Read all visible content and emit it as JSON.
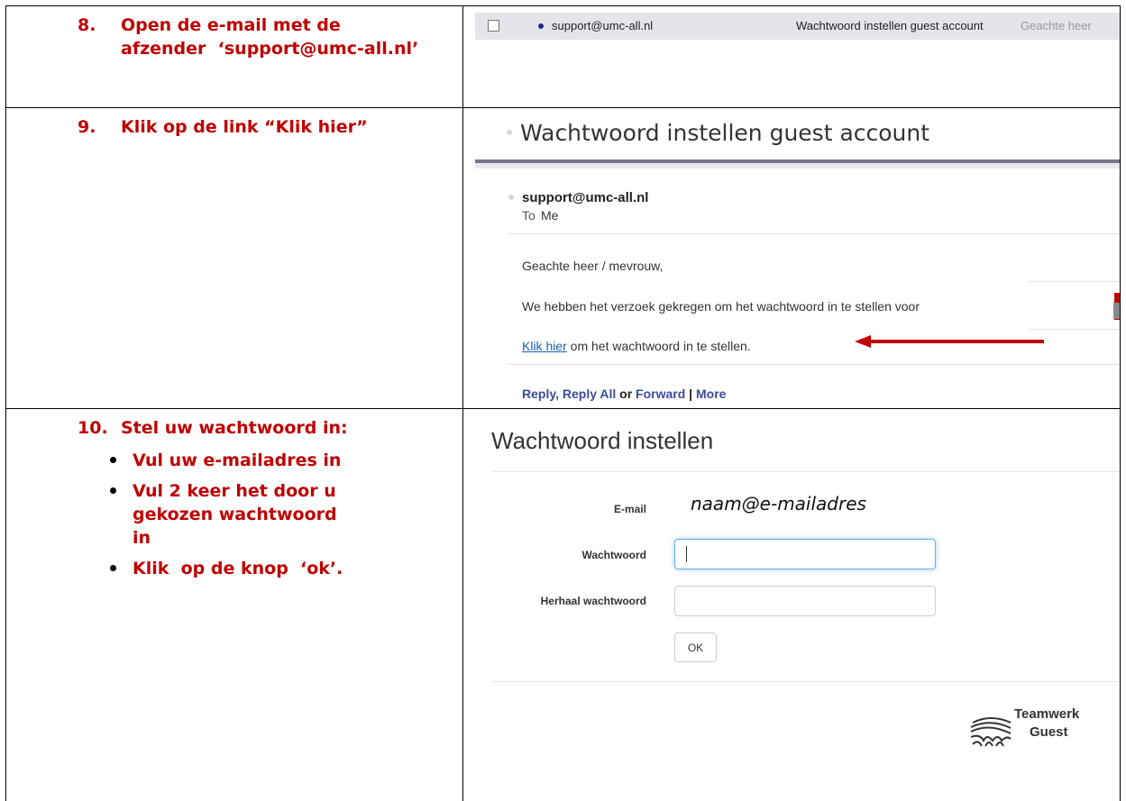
{
  "steps": {
    "step8": {
      "number": "8.",
      "line1": "Open de e-mail met de",
      "line2": "afzender  ‘support@umc-all.nl’"
    },
    "step9": {
      "number": "9.",
      "text": "Klik op de link “Klik hier”"
    },
    "step10": {
      "number": "10.",
      "text": "Stel uw wachtwoord in:",
      "bullets": [
        "Vul uw e-mailadres in",
        "Vul 2 keer het door u gekozen wachtwoord in",
        "Klik  op de knop  ‘ok’."
      ]
    }
  },
  "inbox": {
    "sender": "support@umc-all.nl",
    "subject": "Wachtwoord instellen guest account",
    "preview": "Geachte heer"
  },
  "mail": {
    "title": "Wachtwoord instellen guest account",
    "from": "support@umc-all.nl",
    "to_label": "To",
    "to": "Me",
    "greeting": "Geachte heer / mevrouw,",
    "body": "We hebben het verzoek gekregen om het wachtwoord in te stellen voor",
    "link": "Klik hier",
    "link_suffix": " om het wachtwoord in te stellen.",
    "reply": "Reply",
    "reply_all": "Reply All",
    "or": "or",
    "forward": "Forward",
    "pipe": "|",
    "more": "More"
  },
  "form": {
    "title": "Wachtwoord instellen",
    "email_label": "E-mail",
    "email_value": "naam@e-mailadres",
    "password_label": "Wachtwoord",
    "repeat_label": "Herhaal wachtwoord",
    "ok_label": "OK"
  },
  "logo": {
    "line1": "Teamwerk",
    "line2": "Guest"
  },
  "colors": {
    "instruction_red": "#c00000",
    "link_blue": "#1a5fb4",
    "reply_blue": "#3b4c9a"
  }
}
